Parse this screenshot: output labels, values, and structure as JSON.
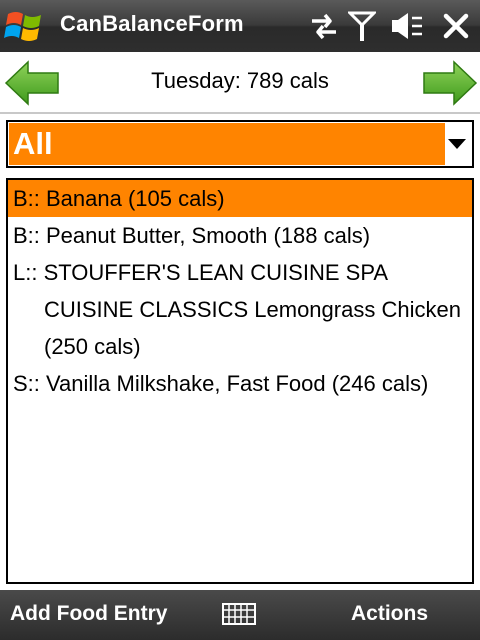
{
  "titlebar": {
    "app_title": "CanBalanceForm",
    "icons": [
      "windows-start-logo",
      "connectivity-icon",
      "signal-icon",
      "volume-muted-icon",
      "close-icon"
    ]
  },
  "nav": {
    "day_summary": "Tuesday: 789 cals",
    "prev_icon": "left-arrow-icon",
    "next_icon": "right-arrow-icon"
  },
  "filter": {
    "selected": "All"
  },
  "entries": [
    {
      "text": "B:: Banana (105 cals)",
      "selected": true
    },
    {
      "text": "B:: Peanut Butter, Smooth (188 cals)",
      "selected": false
    },
    {
      "text": "L:: STOUFFER'S LEAN CUISINE SPA CUISINE CLASSICS Lemongrass Chicken (250 cals)",
      "selected": false
    },
    {
      "text": "S:: Vanilla Milkshake, Fast Food (246 cals)",
      "selected": false
    }
  ],
  "softkeys": {
    "left": "Add Food Entry",
    "center_icon": "keyboard-icon",
    "right": "Actions"
  },
  "colors": {
    "accent": "#ff8400",
    "arrow_green": "#5fb832",
    "bar_dark": "#2e2e2e"
  }
}
